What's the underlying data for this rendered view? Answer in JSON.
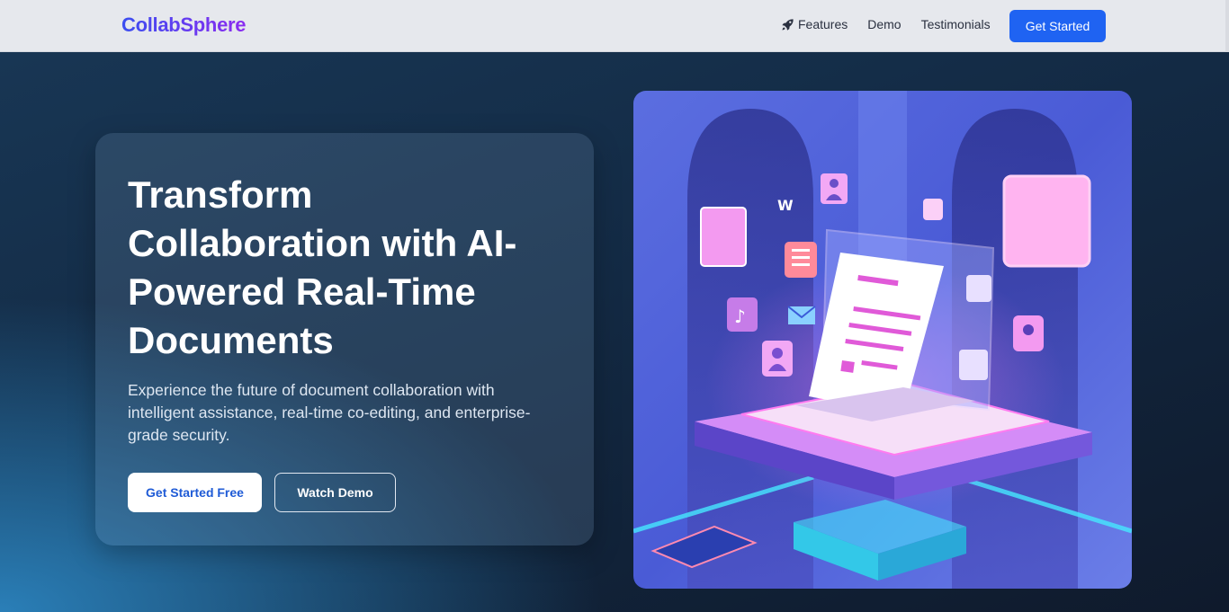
{
  "brand": {
    "name": "CollabSphere"
  },
  "nav": {
    "links": [
      {
        "label": "Features",
        "icon": "rocket-icon"
      },
      {
        "label": "Demo"
      },
      {
        "label": "Testimonials"
      }
    ],
    "cta_label": "Get Started"
  },
  "hero": {
    "title": "Transform Collaboration with AI-Powered Real-Time Documents",
    "subtitle": "Experience the future of document collaboration with intelligent assistance, real-time co-editing, and enterprise-grade security.",
    "primary_button": "Get Started Free",
    "secondary_button": "Watch Demo",
    "image_letter": "W"
  },
  "colors": {
    "accent": "#1f63f2",
    "brand_gradient_start": "#3b4ef0",
    "brand_gradient_end": "#8b2bf0",
    "hero_dark": "#0f1a2c"
  }
}
